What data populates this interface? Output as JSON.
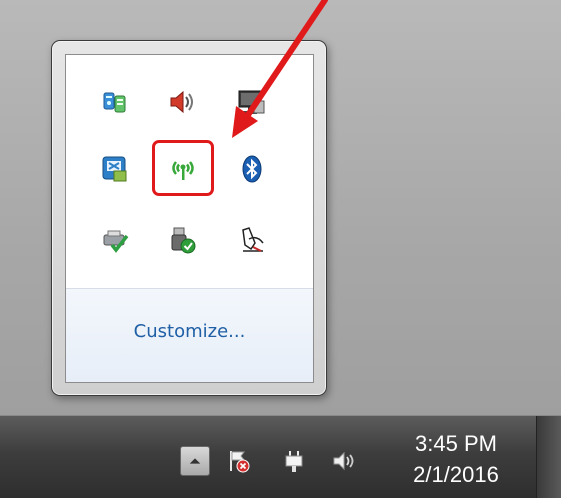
{
  "tray_overflow": {
    "icons": [
      {
        "name": "device-manager-icon"
      },
      {
        "name": "speaker-muted-icon"
      },
      {
        "name": "monitor-icon"
      },
      {
        "name": "remote-desktop-icon"
      },
      {
        "name": "wireless-network-icon"
      },
      {
        "name": "bluetooth-icon"
      },
      {
        "name": "printer-check-icon"
      },
      {
        "name": "usb-safely-remove-icon"
      },
      {
        "name": "tablet-pen-icon"
      }
    ],
    "customize_label": "Customize..."
  },
  "taskbar": {
    "clock": {
      "time": "3:45 PM",
      "date": "2/1/2016"
    },
    "tray_icons": [
      "show-hidden-icons-button",
      "action-center-flag-icon",
      "power-plug-icon",
      "volume-icon"
    ]
  },
  "annotation": {
    "color": "#e0191b"
  }
}
